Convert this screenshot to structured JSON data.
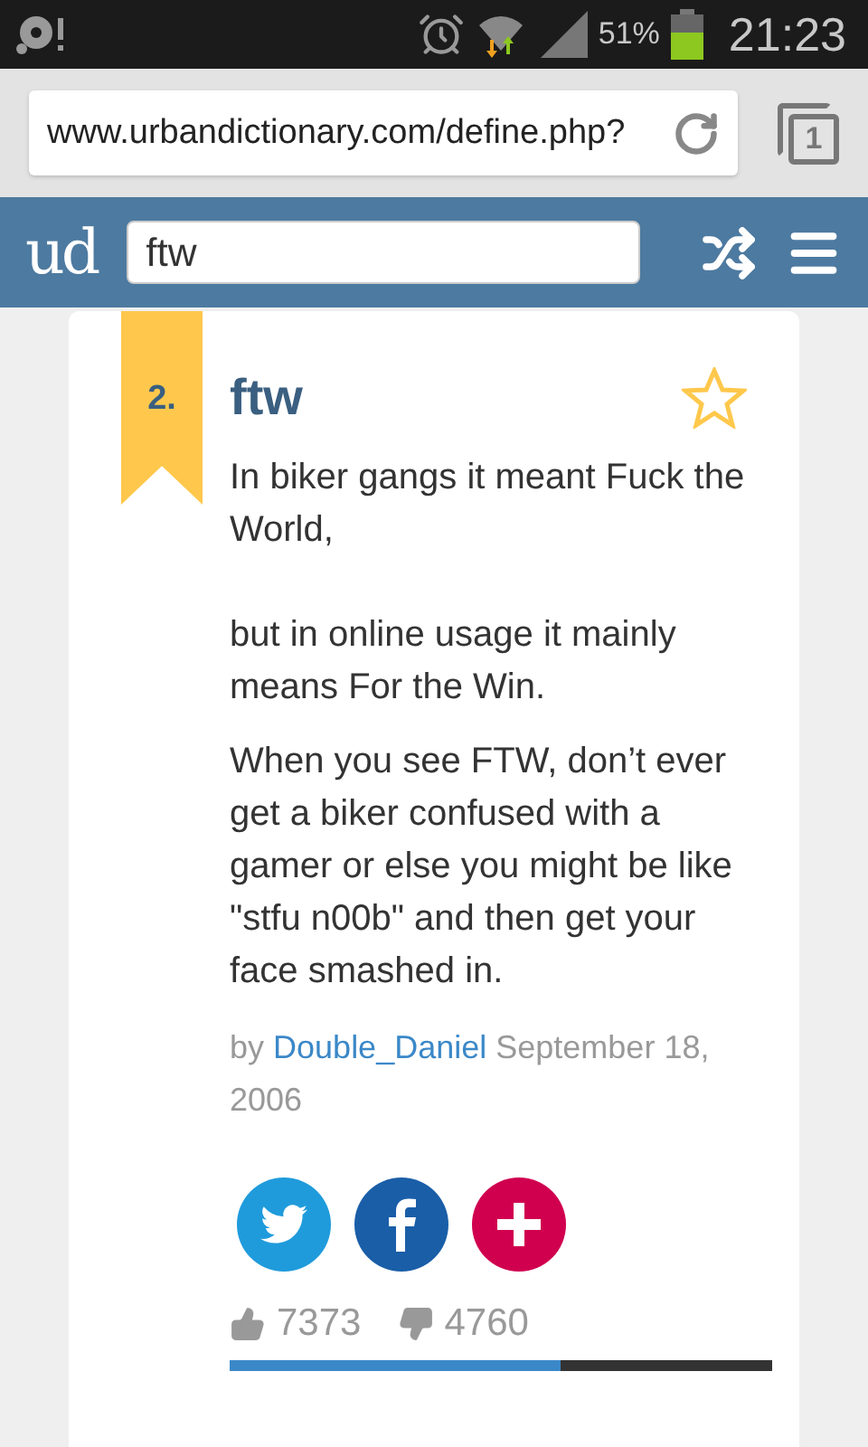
{
  "status_bar": {
    "battery": "51%",
    "time": "21:23"
  },
  "browser": {
    "url": "www.urbandictionary.com/define.php?",
    "tab_count": "1"
  },
  "header": {
    "logo": "ud",
    "search_value": "ftw"
  },
  "entry": {
    "rank": "2.",
    "word": "ftw",
    "favorited": false,
    "meaning": "In biker gangs it meant Fuck the World,\n\nbut in online usage it mainly means For the Win.",
    "example": "When you see FTW, don’t ever get a biker confused with a gamer or else you might be like \"stfu n00b\" and then get your face smashed in.",
    "byline": {
      "prefix": "by",
      "author": "Double_Daniel",
      "date": "September 18, 2006"
    },
    "share_buttons": [
      {
        "kind": "twitter",
        "color": "#1f9bdc"
      },
      {
        "kind": "facebook",
        "color": "#1a5ea8"
      },
      {
        "kind": "plus",
        "color": "#d0004f"
      }
    ],
    "votes": {
      "up": "7373",
      "down": "4760",
      "level": 0.61
    }
  }
}
